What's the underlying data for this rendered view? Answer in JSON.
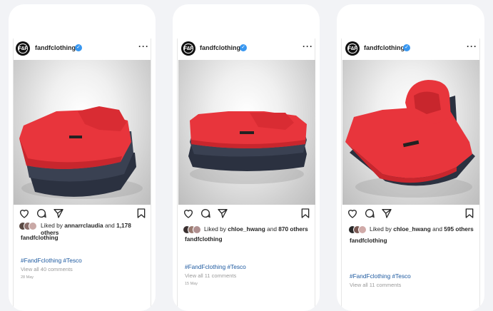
{
  "posts": [
    {
      "username": "fandfclothing",
      "avatar_text": "F&F",
      "liked_by_prefix": "Liked by ",
      "liked_by_user": "annarrclaudia",
      "liked_by_and": " and ",
      "liked_by_count": "1,178",
      "liked_by_suffix": "others",
      "owner": "fandfclothing",
      "hashtags": "#FandFclothing #Tesco",
      "view_comments": "View all 40 comments",
      "date": "28 May",
      "logo_text": "F&F"
    },
    {
      "username": "fandfclothing",
      "avatar_text": "F&F",
      "liked_by_prefix": "Liked by ",
      "liked_by_user": "chloe_hwang",
      "liked_by_and": " and ",
      "liked_by_count": "870 others",
      "liked_by_suffix": "",
      "owner": "fandfclothing",
      "hashtags": "#FandFclothing #Tesco",
      "view_comments": "View all 11 comments",
      "date": "15 May",
      "logo_text": "F&F"
    },
    {
      "username": "fandfclothing",
      "avatar_text": "F&F",
      "liked_by_prefix": "Liked by ",
      "liked_by_user": "chloe_hwang",
      "liked_by_and": " and ",
      "liked_by_count": "595 others",
      "liked_by_suffix": "",
      "owner": "fandfclothing",
      "hashtags": "#FandFclothing #Tesco",
      "view_comments": "View all 11 comments",
      "date": "",
      "logo_text": "F&F"
    }
  ],
  "icons": [
    "heart-icon",
    "comment-icon",
    "share-icon",
    "bookmark-icon",
    "more-icon",
    "verified-icon"
  ],
  "colors": {
    "background": "#f2f3f6",
    "hoodie_red": "#e8353c",
    "hoodie_navy": "#2b3140",
    "hashtag": "#1e5aa0",
    "verified": "#3897f0"
  }
}
